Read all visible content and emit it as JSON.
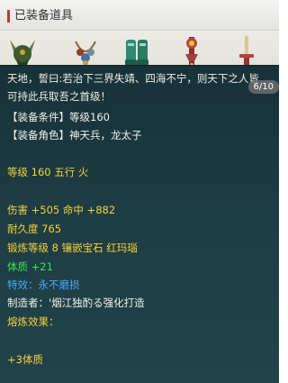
{
  "panel": {
    "title": "已装备道具"
  },
  "equipment_slots": [
    {
      "icon": "horned-helmet-icon"
    },
    {
      "icon": "necklace-icon"
    },
    {
      "icon": "armor-icon"
    },
    {
      "icon": "belt-icon"
    },
    {
      "icon": "sword-icon"
    }
  ],
  "tooltip": {
    "description_line1": "天地，誓曰:若治下三界失靖、四海不宁，则天下之人皆",
    "description_line2": "可持此兵取吾之首级！",
    "page_indicator": "6/10",
    "requirement": "【装备条件】等级160",
    "role": "【装备角色】神天兵，龙太子",
    "level_element": "等级 160  五行 火",
    "damage_hit": "伤害 +505 命中 +882",
    "durability": "耐久度 765",
    "forge": "锻炼等级 8  镶嵌宝石 红玛瑙",
    "constitution": "体质 +21",
    "special_effect": "特效：永不磨损",
    "maker": "制造者：'烟江独酌る强化打造",
    "refine_label": "熔炼效果：",
    "refine_value": "+3体质"
  },
  "colors": {
    "tooltip_bg": "#1e3c43",
    "text_white": "#f0f0ea",
    "text_yellow": "#f4d23c",
    "text_green": "#35e84a",
    "text_blue": "#47a8ff",
    "header_accent": "#c0392b"
  }
}
